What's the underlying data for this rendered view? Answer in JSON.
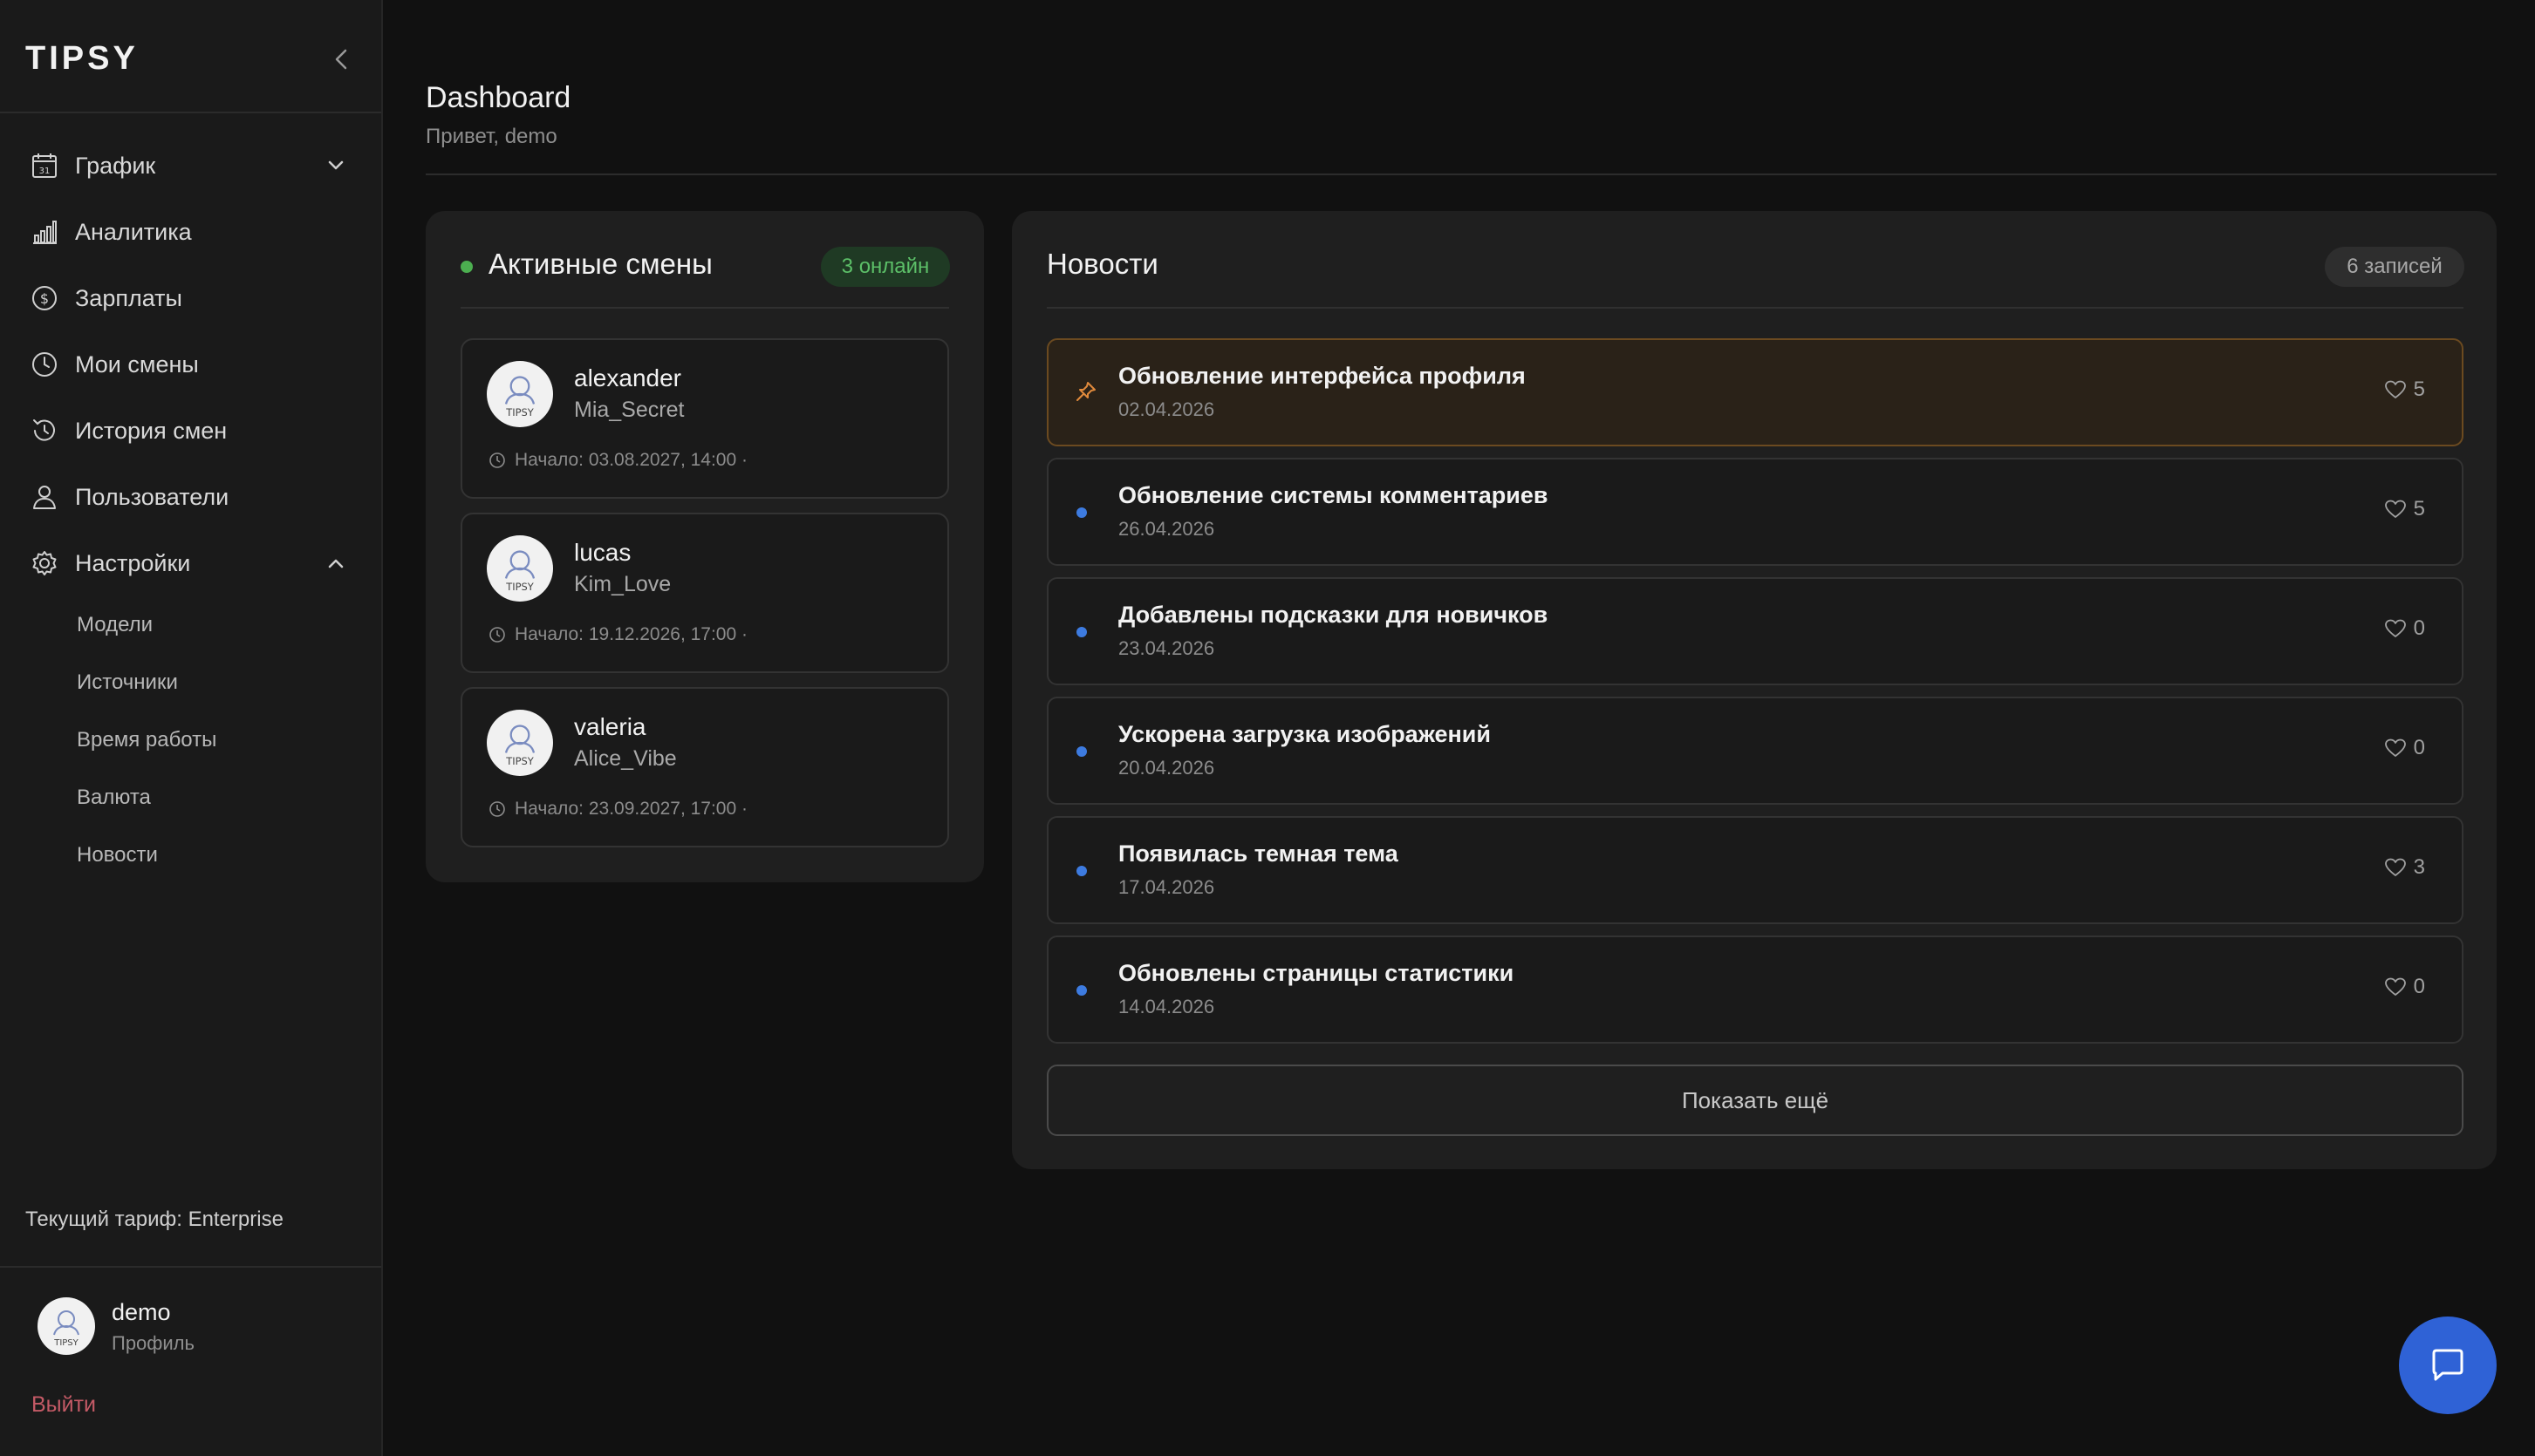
{
  "app": {
    "logo": "TIPSY"
  },
  "sidebar": {
    "items": [
      {
        "label": "График",
        "icon": "calendar-icon"
      },
      {
        "label": "Аналитика",
        "icon": "bar-chart-icon"
      },
      {
        "label": "Зарплаты",
        "icon": "dollar-coin-icon"
      },
      {
        "label": "Мои смены",
        "icon": "clock-icon"
      },
      {
        "label": "История смен",
        "icon": "history-icon"
      },
      {
        "label": "Пользователи",
        "icon": "user-icon"
      },
      {
        "label": "Настройки",
        "icon": "gear-icon"
      }
    ],
    "settings_sub": [
      "Модели",
      "Источники",
      "Время работы",
      "Валюта",
      "Новости"
    ],
    "tariff": "Текущий тариф: Enterprise",
    "user": {
      "name": "demo",
      "sub": "Профиль",
      "avatar_text": "TIPSY"
    },
    "logout": "Выйти"
  },
  "header": {
    "title": "Dashboard",
    "greeting": "Привет, demo"
  },
  "shifts": {
    "title": "Активные смены",
    "badge": "3 онлайн",
    "items": [
      {
        "name": "alexander",
        "alias": "Mia_Secret",
        "start": "Начало: 03.08.2027, 14:00 ·",
        "avatar_text": "TIPSY"
      },
      {
        "name": "lucas",
        "alias": "Kim_Love",
        "start": "Начало: 19.12.2026, 17:00 ·",
        "avatar_text": "TIPSY"
      },
      {
        "name": "valeria",
        "alias": "Alice_Vibe",
        "start": "Начало: 23.09.2027, 17:00 ·",
        "avatar_text": "TIPSY"
      }
    ]
  },
  "news": {
    "title": "Новости",
    "badge": "6 записей",
    "items": [
      {
        "title": "Обновление интерфейса профиля",
        "date": "02.04.2026",
        "likes": "5",
        "pinned": true
      },
      {
        "title": "Обновление системы комментариев",
        "date": "26.04.2026",
        "likes": "5",
        "pinned": false
      },
      {
        "title": "Добавлены подсказки для новичков",
        "date": "23.04.2026",
        "likes": "0",
        "pinned": false
      },
      {
        "title": "Ускорена загрузка изображений",
        "date": "20.04.2026",
        "likes": "0",
        "pinned": false
      },
      {
        "title": "Появилась темная тема",
        "date": "17.04.2026",
        "likes": "3",
        "pinned": false
      },
      {
        "title": "Обновлены страницы статистики",
        "date": "14.04.2026",
        "likes": "0",
        "pinned": false
      }
    ],
    "show_more": "Показать ещё"
  },
  "colors": {
    "accent": "#2f62d6",
    "online": "#4caf50",
    "pinned_border": "#6b4a20",
    "logout": "#c45a66"
  }
}
